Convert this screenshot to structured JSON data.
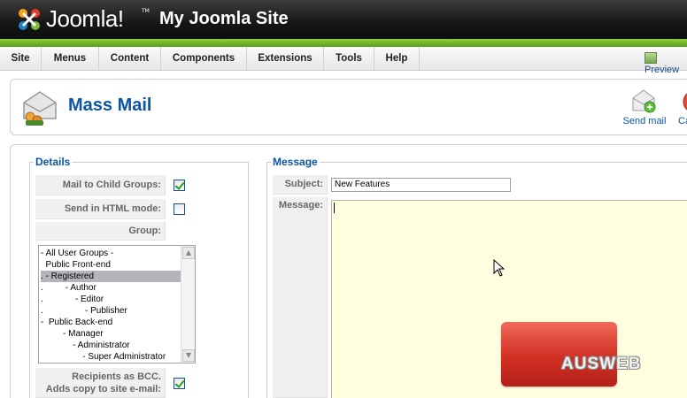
{
  "header": {
    "logo_text": "Joomla!",
    "logo_tm": "TM",
    "site_title": "My Joomla Site"
  },
  "menu": {
    "items": [
      "Site",
      "Menus",
      "Content",
      "Components",
      "Extensions",
      "Tools",
      "Help"
    ],
    "preview": "Preview"
  },
  "toolbar": {
    "page_title": "Mass Mail",
    "send_mail": "Send mail",
    "cancel": "Ca"
  },
  "details": {
    "legend": "Details",
    "mail_child_groups_label": "Mail to Child Groups:",
    "mail_child_groups_checked": true,
    "html_mode_label": "Send in HTML mode:",
    "html_mode_checked": false,
    "group_label": "Group:",
    "group_options": [
      "- All User Groups -",
      "  Public Front-end",
      ". - Registered",
      ".         - Author",
      ".             - Editor",
      ".                 - Publisher",
      "-  Public Back-end",
      "         - Manager",
      "             - Administrator",
      "                 - Super Administrator"
    ],
    "group_selected_index": 2,
    "bcc_label_line1": "Recipients as BCC.",
    "bcc_label_line2": "Adds copy to site e-mail:",
    "bcc_checked": true
  },
  "message": {
    "legend": "Message",
    "subject_label": "Subject:",
    "subject_value": "New Features",
    "message_label": "Message:"
  },
  "watermark": {
    "text": "AUSWEB"
  },
  "colors": {
    "accent_blue": "#0b55a3",
    "header_dark": "#161616",
    "header_green": "#6fb52a",
    "message_bg": "#ffffe0",
    "watermark_red": "#d32f24"
  }
}
